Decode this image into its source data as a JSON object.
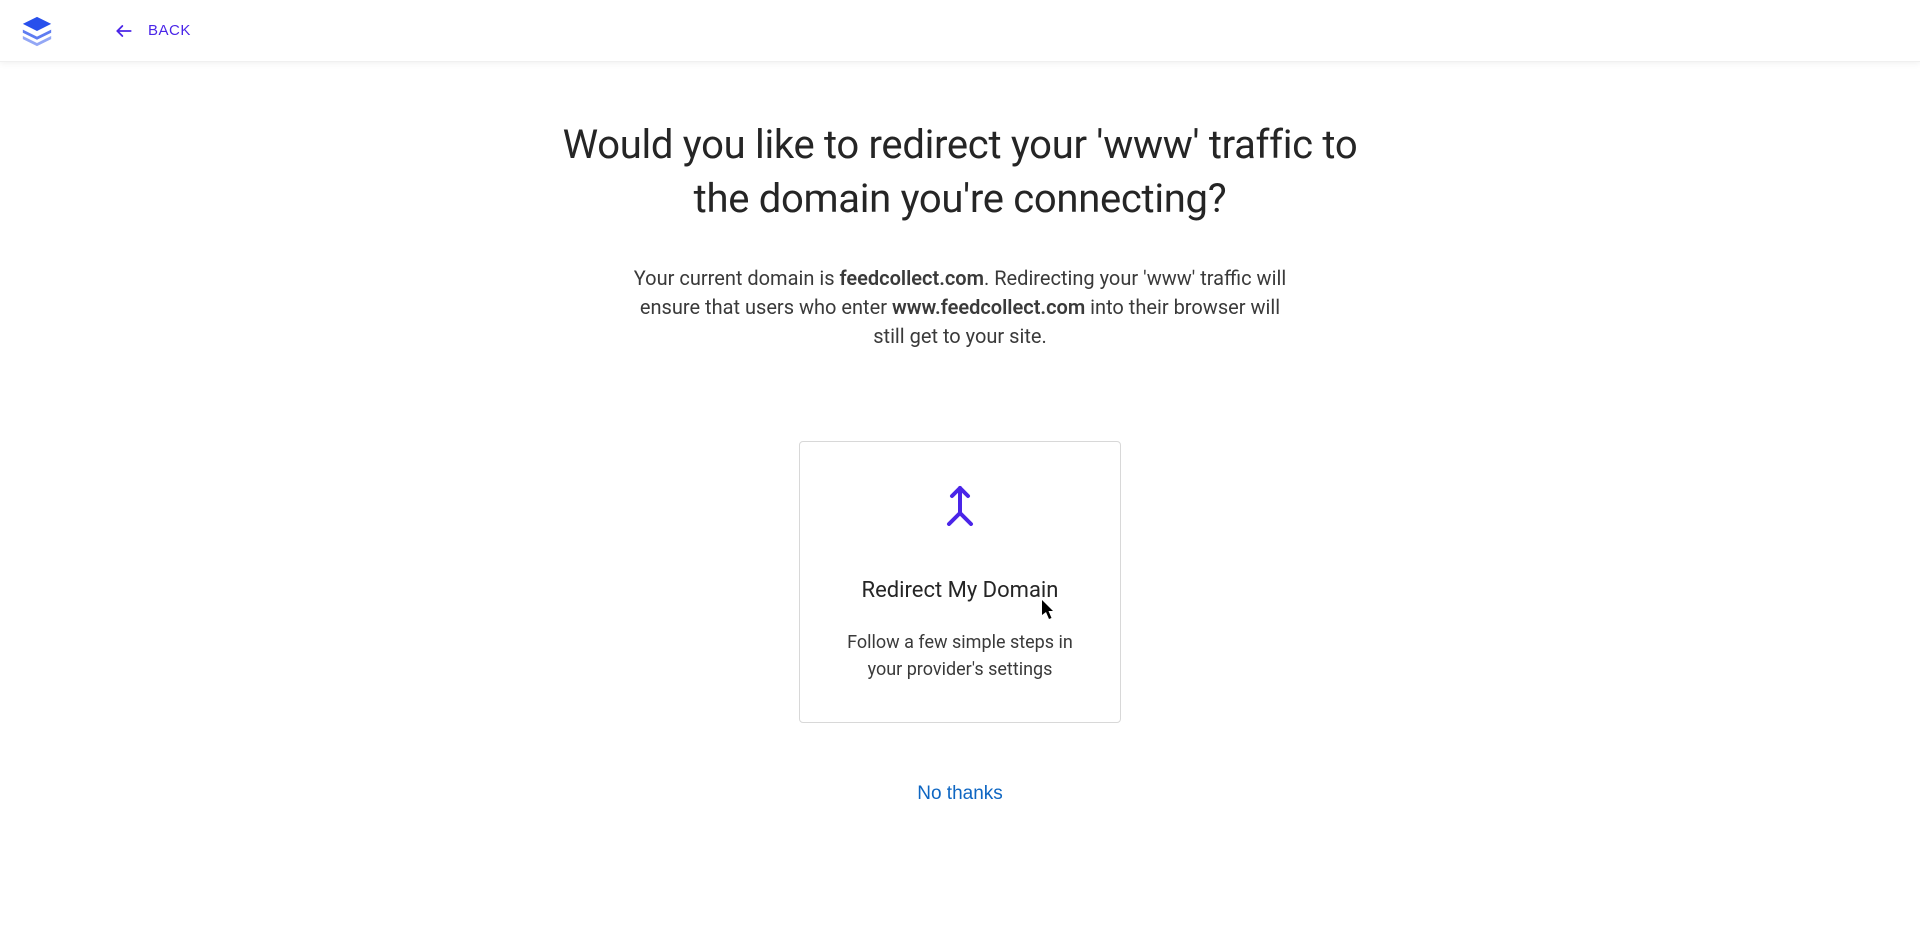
{
  "header": {
    "back_label": "BACK"
  },
  "main": {
    "title": "Would you like to redirect your 'www' traffic to the domain you're connecting?",
    "description_part1": "Your current domain is ",
    "description_domain1": "feedcollect.com",
    "description_part2": ". Redirecting your 'www' traffic will ensure that users who enter ",
    "description_domain2": "www.feedcollect.com",
    "description_part3": " into their browser will still get to your site."
  },
  "card": {
    "title": "Redirect My Domain",
    "description": "Follow a few simple steps in your provider's settings"
  },
  "footer": {
    "no_thanks_label": "No thanks"
  }
}
